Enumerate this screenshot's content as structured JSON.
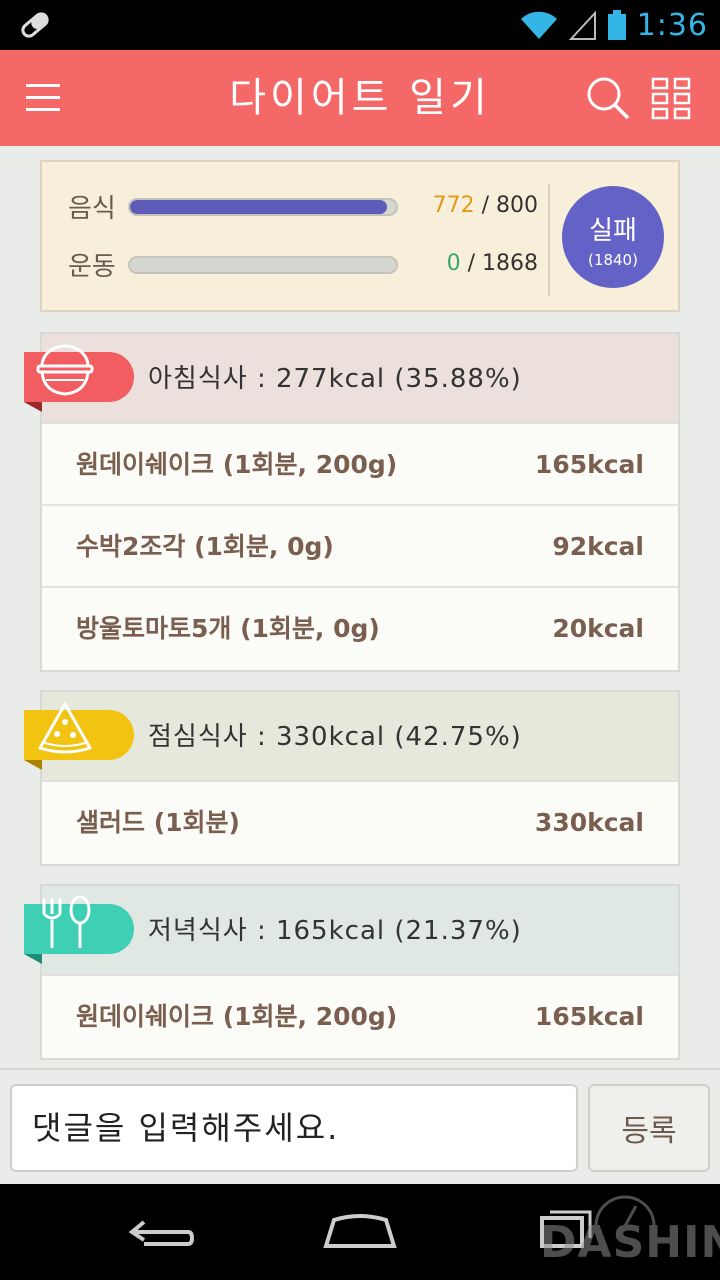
{
  "status_bar": {
    "time": "1:36"
  },
  "app_bar": {
    "title": "다이어트 일기"
  },
  "summary": {
    "food": {
      "label": "음식",
      "current": "772",
      "target": "800",
      "fraction": 0.965
    },
    "exercise": {
      "label": "운동",
      "current": "0",
      "target": "1868",
      "fraction": 0.0
    },
    "separator": "/",
    "result": {
      "label": "실패",
      "value": "(1840)"
    },
    "colors": {
      "food_bar": "#5e5cb8",
      "food_current": "#e09a1a",
      "exercise_current": "#3aa86b",
      "badge": "#6462c6"
    }
  },
  "meals": [
    {
      "header": "아침식사 : 277kcal (35.88%)",
      "icon": "bowl-icon",
      "tag_color": "#f25d62",
      "header_bg": "#ebe0dc",
      "items": [
        {
          "name": "원데이쉐이크 (1회분, 200g)",
          "kcal": "165kcal"
        },
        {
          "name": "수박2조각 (1회분, 0g)",
          "kcal": "92kcal"
        },
        {
          "name": "방울토마토5개 (1회분, 0g)",
          "kcal": "20kcal"
        }
      ]
    },
    {
      "header": "점심식사 : 330kcal (42.75%)",
      "icon": "pizza-slice-icon",
      "tag_color": "#f3c312",
      "header_bg": "#e6e8dc",
      "items": [
        {
          "name": "샐러드 (1회분)",
          "kcal": "330kcal"
        }
      ]
    },
    {
      "header": "저녁식사 : 165kcal (21.37%)",
      "icon": "fork-spoon-icon",
      "tag_color": "#3fcfb4",
      "header_bg": "#dfe8e2",
      "items": [
        {
          "name": "원데이쉐이크 (1회분, 200g)",
          "kcal": "165kcal"
        }
      ]
    }
  ],
  "comment": {
    "placeholder": "댓글을 입력해주세요.",
    "submit_label": "등록"
  },
  "watermark": {
    "text": "DASHIN"
  },
  "accent_color": "#f46868"
}
